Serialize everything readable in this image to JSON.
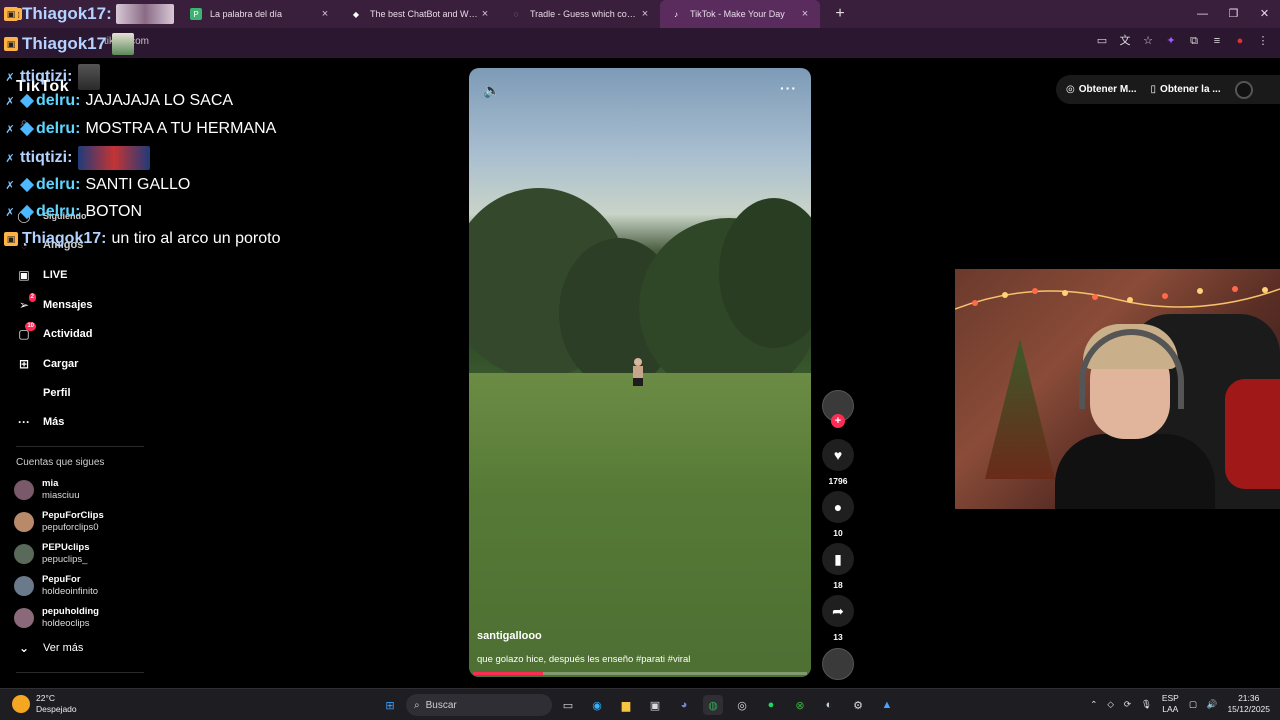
{
  "browser": {
    "tabs": [
      {
        "title": "",
        "icon": "twitch-icon",
        "active": false
      },
      {
        "title": "La palabra del día",
        "icon": "p-icon",
        "active": false
      },
      {
        "title": "The best ChatBot and Widgets",
        "icon": "chatbot-icon",
        "active": false
      },
      {
        "title": "Tradle - Guess which country ex",
        "icon": "tradle-icon",
        "active": false
      },
      {
        "title": "TikTok - Make Your Day",
        "icon": "tiktok-icon",
        "active": true
      }
    ],
    "url": "tiktok.com"
  },
  "chat_overlay": {
    "top_user": "Thiagok17:",
    "top_user2": "Thiagok17",
    "messages": [
      {
        "user": "ttiqtizi:",
        "text": "",
        "emote": true,
        "color": "#b4d2ff"
      },
      {
        "user": "delru:",
        "text": "JAJAJAJA LO SACA",
        "emote": false,
        "color": "#5fd6ff"
      },
      {
        "user": "delru:",
        "text": "MOSTRA A TU HERMANA",
        "emote": false,
        "color": "#5fd6ff"
      },
      {
        "user": "ttiqtizi:",
        "text": "",
        "emote": true,
        "color": "#b4d2ff"
      },
      {
        "user": "delru:",
        "text": "SANTI GALLO",
        "emote": false,
        "color": "#5fd6ff"
      },
      {
        "user": "delru:",
        "text": "BOTON",
        "emote": false,
        "color": "#5fd6ff"
      },
      {
        "user": "Thiagok17:",
        "text": "un tiro al arco un poroto",
        "emote": false,
        "color": "#b4d2ff"
      }
    ]
  },
  "sidebar": {
    "logo": "TikTok",
    "nav": [
      {
        "label": "LIVE",
        "icon": "live-icon",
        "badge": ""
      },
      {
        "label": "Mensajes",
        "icon": "messages-icon",
        "badge": "2"
      },
      {
        "label": "Actividad",
        "icon": "activity-icon",
        "badge": "10"
      },
      {
        "label": "Cargar",
        "icon": "upload-icon",
        "badge": ""
      },
      {
        "label": "Perfil",
        "icon": "profile-icon",
        "badge": ""
      },
      {
        "label": "Más",
        "icon": "more-icon",
        "badge": ""
      }
    ],
    "partial_items": [
      "Siguiendo",
      "Amigos"
    ],
    "following_header": "Cuentas que sigues",
    "following": [
      {
        "name": "mia",
        "handle": "miasciuu"
      },
      {
        "name": "PepuForClips",
        "handle": "pepuforclips0"
      },
      {
        "name": "PEPUclips",
        "handle": "pepuclips_"
      },
      {
        "name": "PepuFor",
        "handle": "holdeoinfinito"
      },
      {
        "name": "pepuholding",
        "handle": "holdeoclips"
      }
    ],
    "see_more": "Ver más"
  },
  "video": {
    "author": "santigallooo",
    "caption": "que golazo hice, después les enseño #parati #viral",
    "progress": 0.21
  },
  "actions": {
    "likes": "1796",
    "comments": "10",
    "saves": "18",
    "shares": "13"
  },
  "top_buttons": {
    "get_app": "Obtener M...",
    "get_desktop": "Obtener la ..."
  },
  "taskbar": {
    "temperature": "22°C",
    "weather": "Despejado",
    "search_placeholder": "Buscar",
    "lang_top": "ESP",
    "lang_bottom": "LAA",
    "time": "21:36",
    "date": "15/12/2025"
  }
}
